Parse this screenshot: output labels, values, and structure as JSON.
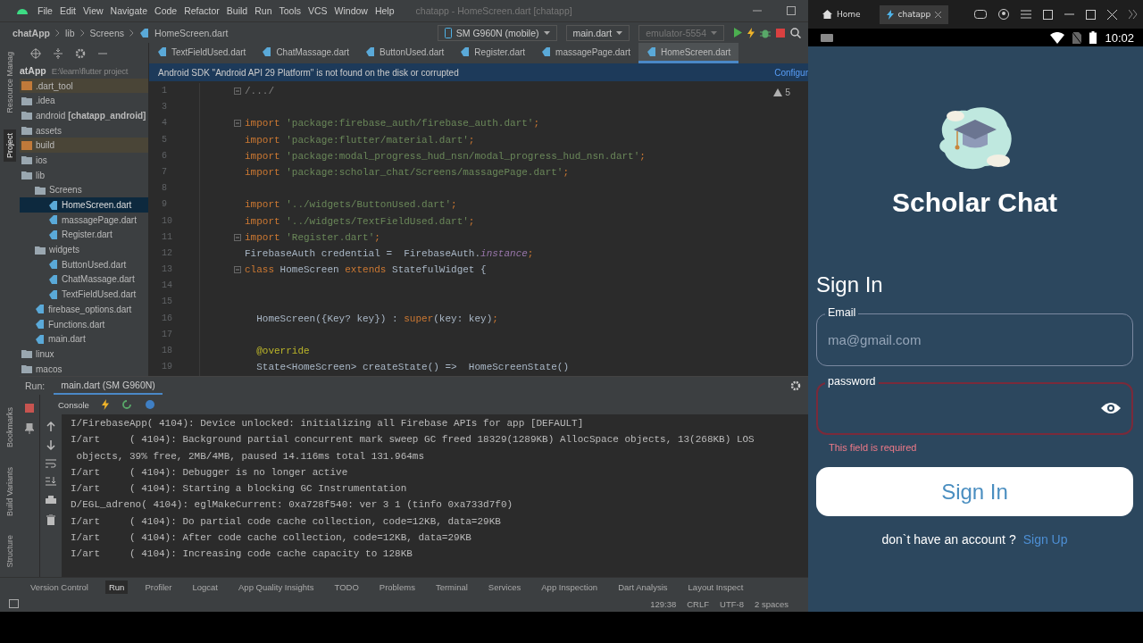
{
  "ide": {
    "menu": [
      "File",
      "Edit",
      "View",
      "Navigate",
      "Code",
      "Refactor",
      "Build",
      "Run",
      "Tools",
      "VCS",
      "Window",
      "Help"
    ],
    "title": "chatapp - HomeScreen.dart [chatapp]",
    "breadcrumbs": [
      "chatApp",
      "lib",
      "Screens",
      "HomeScreen.dart"
    ],
    "device": "SM G960N (mobile)",
    "run_config": "main.dart",
    "emulator": "emulator-5554",
    "side_tabs_top": [
      {
        "label": "Resource Manag",
        "selected": false
      },
      {
        "label": "Project",
        "selected": true
      }
    ],
    "side_tabs_bottom": [
      "Bookmarks",
      "Build Variants",
      "Structure"
    ],
    "project": {
      "root": "atApp",
      "path": "E:\\learn\\flutter project",
      "tree": [
        {
          "label": ".dart_tool",
          "kind": "excluded",
          "selected": false
        },
        {
          "label": ".idea",
          "kind": "folder",
          "selected": false
        },
        {
          "label": "android **[chatapp_android]**",
          "kind": "folder",
          "selected": false
        },
        {
          "label": "assets",
          "kind": "folder",
          "selected": false
        },
        {
          "label": "build",
          "kind": "excluded",
          "selected": false
        },
        {
          "label": "ios",
          "kind": "folder",
          "selected": false
        },
        {
          "label": "lib",
          "kind": "folder",
          "selected": false,
          "children": [
            {
              "label": "Screens",
              "kind": "folder",
              "selected": false,
              "children": [
                {
                  "label": "HomeScreen.dart",
                  "kind": "dart",
                  "selected": true
                },
                {
                  "label": "massagePage.dart",
                  "kind": "dart",
                  "selected": false
                },
                {
                  "label": "Register.dart",
                  "kind": "dart",
                  "selected": false
                }
              ]
            },
            {
              "label": "widgets",
              "kind": "folder",
              "selected": false,
              "children": [
                {
                  "label": "ButtonUsed.dart",
                  "kind": "dart",
                  "selected": false
                },
                {
                  "label": "ChatMassage.dart",
                  "kind": "dart",
                  "selected": false
                },
                {
                  "label": "TextFieldUsed.dart",
                  "kind": "dart",
                  "selected": false
                }
              ]
            },
            {
              "label": "firebase_options.dart",
              "kind": "dart",
              "selected": false
            },
            {
              "label": "Functions.dart",
              "kind": "dart",
              "selected": false
            },
            {
              "label": "main.dart",
              "kind": "dart",
              "selected": false
            }
          ]
        },
        {
          "label": "linux",
          "kind": "folder",
          "selected": false
        },
        {
          "label": "macos",
          "kind": "folder",
          "selected": false
        }
      ]
    },
    "editor_tabs": [
      {
        "label": "TextFieldUsed.dart",
        "selected": false
      },
      {
        "label": "ChatMassage.dart",
        "selected": false
      },
      {
        "label": "ButtonUsed.dart",
        "selected": false
      },
      {
        "label": "Register.dart",
        "selected": false
      },
      {
        "label": "massagePage.dart",
        "selected": false
      },
      {
        "label": "HomeScreen.dart",
        "selected": true
      }
    ],
    "banner": {
      "message": "Android SDK \"Android API 29 Platform\" is not found on the disk or corrupted",
      "action": "Configur"
    },
    "warnings": "5",
    "code": [
      {
        "number": "1",
        "fold": true,
        "segments": [
          {
            "kind": "comment",
            "text": "/.../"
          }
        ]
      },
      {
        "number": "3",
        "fold": false
      },
      {
        "number": "4",
        "fold": true,
        "segments": [
          {
            "kind": "keyword",
            "text": "import "
          },
          {
            "kind": "string",
            "text": "'package:firebase_auth/firebase_auth.dart'"
          },
          {
            "kind": "keyword",
            "text": ";"
          }
        ]
      },
      {
        "number": "5",
        "fold": false,
        "segments": [
          {
            "kind": "keyword",
            "text": "import "
          },
          {
            "kind": "string",
            "text": "'package:flutter/material.dart'"
          },
          {
            "kind": "keyword",
            "text": ";"
          }
        ]
      },
      {
        "number": "6",
        "fold": false,
        "segments": [
          {
            "kind": "keyword",
            "text": "import "
          },
          {
            "kind": "string",
            "text": "'package:modal_progress_hud_nsn/modal_progress_hud_nsn.dart'"
          },
          {
            "kind": "keyword",
            "text": ";"
          }
        ]
      },
      {
        "number": "7",
        "fold": false,
        "segments": [
          {
            "kind": "keyword",
            "text": "import "
          },
          {
            "kind": "string",
            "text": "'package:scholar_chat/Screens/massagePage.dart'"
          },
          {
            "kind": "keyword",
            "text": ";"
          }
        ]
      },
      {
        "number": "8",
        "fold": false
      },
      {
        "number": "9",
        "fold": false,
        "segments": [
          {
            "kind": "keyword",
            "text": "import "
          },
          {
            "kind": "string",
            "text": "'../widgets/ButtonUsed.dart'"
          },
          {
            "kind": "keyword",
            "text": ";"
          }
        ]
      },
      {
        "number": "10",
        "fold": false,
        "segments": [
          {
            "kind": "keyword",
            "text": "import "
          },
          {
            "kind": "string",
            "text": "'../widgets/TextFieldUsed.dart'"
          },
          {
            "kind": "keyword",
            "text": ";"
          }
        ]
      },
      {
        "number": "11",
        "fold": true,
        "segments": [
          {
            "kind": "keyword",
            "text": "import "
          },
          {
            "kind": "string",
            "text": "'Register.dart'"
          },
          {
            "kind": "keyword",
            "text": ";"
          }
        ]
      },
      {
        "number": "12",
        "fold": false,
        "segments": [
          {
            "kind": "plain",
            "text": "FirebaseAuth credential =  FirebaseAuth."
          },
          {
            "kind": "field",
            "text": "instance"
          },
          {
            "kind": "keyword",
            "text": ";"
          }
        ]
      },
      {
        "number": "13",
        "fold": true,
        "segments": [
          {
            "kind": "keyword",
            "text": "class "
          },
          {
            "kind": "plain",
            "text": "HomeScreen "
          },
          {
            "kind": "keyword",
            "text": "extends "
          },
          {
            "kind": "plain",
            "text": "StatefulWidget {"
          }
        ]
      },
      {
        "number": "14",
        "fold": false
      },
      {
        "number": "15",
        "fold": false
      },
      {
        "number": "16",
        "fold": false,
        "segments": [
          {
            "kind": "plain",
            "text": "  HomeScreen({Key? key}) : "
          },
          {
            "kind": "keyword",
            "text": "super"
          },
          {
            "kind": "plain",
            "text": "(key: key)"
          },
          {
            "kind": "keyword",
            "text": ";"
          }
        ]
      },
      {
        "number": "17",
        "fold": false
      },
      {
        "number": "18",
        "fold": false,
        "segments": [
          {
            "kind": "annotation",
            "text": "  @override"
          }
        ]
      },
      {
        "number": "19",
        "fold": false,
        "segments": [
          {
            "kind": "plain",
            "text": "  State<HomeScreen> createState() =>  HomeScreenState()"
          }
        ]
      }
    ],
    "run": {
      "label": "Run:",
      "tab": "main.dart (SM G960N)",
      "console": "Console",
      "log": [
        "I/FirebaseApp( 4104): Device unlocked: initializing all Firebase APIs for app [DEFAULT]",
        "I/art     ( 4104): Background partial concurrent mark sweep GC freed 18329(1289KB) AllocSpace objects, 13(268KB) LOS",
        " objects, 39% free, 2MB/4MB, paused 14.116ms total 131.964ms",
        "I/art     ( 4104): Debugger is no longer active",
        "I/art     ( 4104): Starting a blocking GC Instrumentation",
        "D/EGL_adreno( 4104): eglMakeCurrent: 0xa728f540: ver 3 1 (tinfo 0xa733d7f0)",
        "I/art     ( 4104): Do partial code cache collection, code=12KB, data=29KB",
        "I/art     ( 4104): After code cache collection, code=12KB, data=29KB",
        "I/art     ( 4104): Increasing code cache capacity to 128KB"
      ]
    },
    "tool_windows": [
      {
        "label": "Version Control",
        "selected": false
      },
      {
        "label": "Run",
        "selected": true
      },
      {
        "label": "Profiler",
        "selected": false
      },
      {
        "label": "Logcat",
        "selected": false
      },
      {
        "label": "App Quality Insights",
        "selected": false
      },
      {
        "label": "TODO",
        "selected": false
      },
      {
        "label": "Problems",
        "selected": false
      },
      {
        "label": "Terminal",
        "selected": false
      },
      {
        "label": "Services",
        "selected": false
      },
      {
        "label": "App Inspection",
        "selected": false
      },
      {
        "label": "Dart Analysis",
        "selected": false
      },
      {
        "label": "Layout Inspect",
        "selected": false
      }
    ],
    "status": [
      "129:38",
      "CRLF",
      "UTF-8",
      "2 spaces"
    ]
  },
  "emulator": {
    "tabs": [
      {
        "label": "Home",
        "selected": false
      },
      {
        "label": "chatapp",
        "selected": true
      }
    ],
    "time": "10:02",
    "app": {
      "title": "Scholar Chat",
      "heading": "Sign In",
      "fields": [
        {
          "label": "Email",
          "placeholder": "ma@gmail.com",
          "error": false
        },
        {
          "label": "password",
          "error": true,
          "error_text": "This field is required"
        }
      ],
      "button": "Sign In",
      "prompt": "don`t have an account ?",
      "link": "Sign Up"
    }
  }
}
